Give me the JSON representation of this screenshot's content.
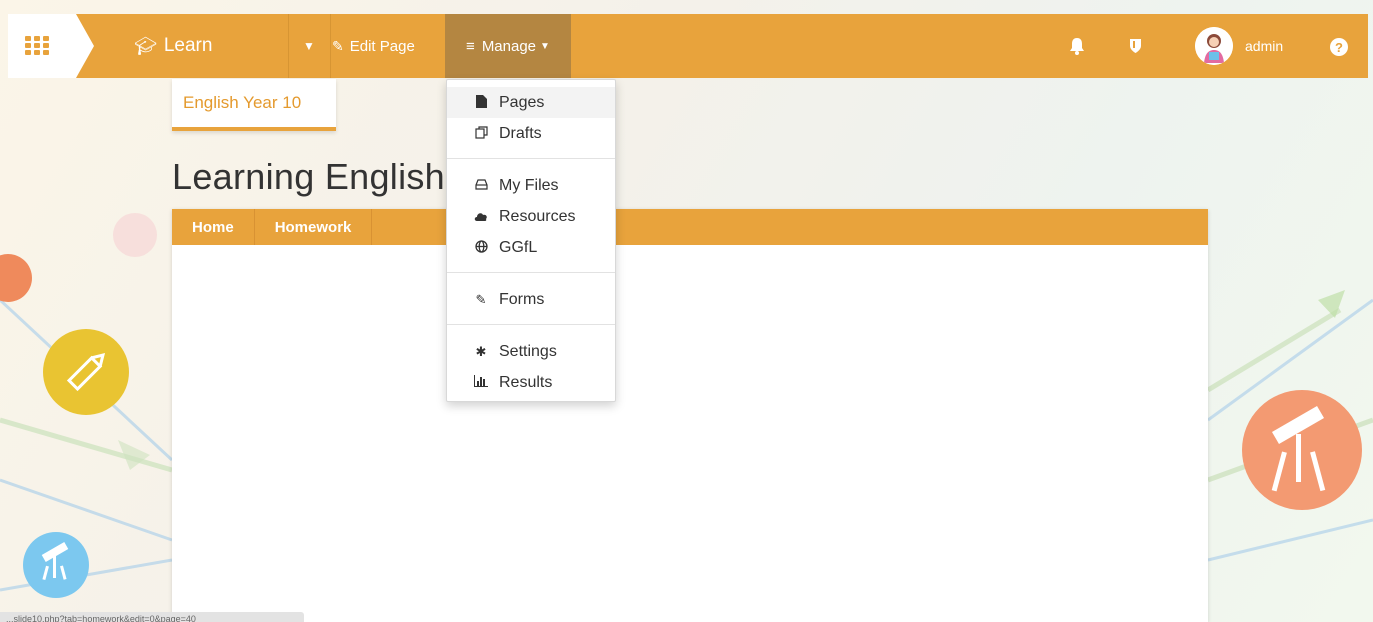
{
  "nav": {
    "learn_label": "Learn",
    "edit_page_label": "Edit Page",
    "manage_label": "Manage",
    "admin_label": "admin",
    "help_glyph": "?"
  },
  "icons": {
    "apps": "grid-icon",
    "learn": "graduation-cap-icon",
    "dropdown": "caret-down-icon",
    "edit": "edit-icon",
    "manage": "bars-icon",
    "bell": "bell-icon",
    "shield": "shield-icon",
    "help": "question-circle-icon"
  },
  "colors": {
    "accent": "#e8a33c",
    "manage_active": "#b48641",
    "course_tab_text": "#e49a2e"
  },
  "course": {
    "name": "English Year 10"
  },
  "page": {
    "title": "Learning English"
  },
  "tabs": [
    {
      "label": "Home"
    },
    {
      "label": "Homework"
    }
  ],
  "manage_menu": {
    "groups": [
      [
        {
          "label": "Pages",
          "icon": "file-icon"
        },
        {
          "label": "Drafts",
          "icon": "copy-icon"
        }
      ],
      [
        {
          "label": "My Files",
          "icon": "hdd-icon"
        },
        {
          "label": "Resources",
          "icon": "cloud-icon"
        },
        {
          "label": "GGfL",
          "icon": "globe-icon"
        }
      ],
      [
        {
          "label": "Forms",
          "icon": "edit-icon"
        }
      ],
      [
        {
          "label": "Settings",
          "icon": "gear-icon"
        },
        {
          "label": "Results",
          "icon": "bar-chart-icon"
        }
      ]
    ]
  },
  "statusbar": {
    "text": "...slide10.php?tab=homework&edit=0&page=40"
  }
}
